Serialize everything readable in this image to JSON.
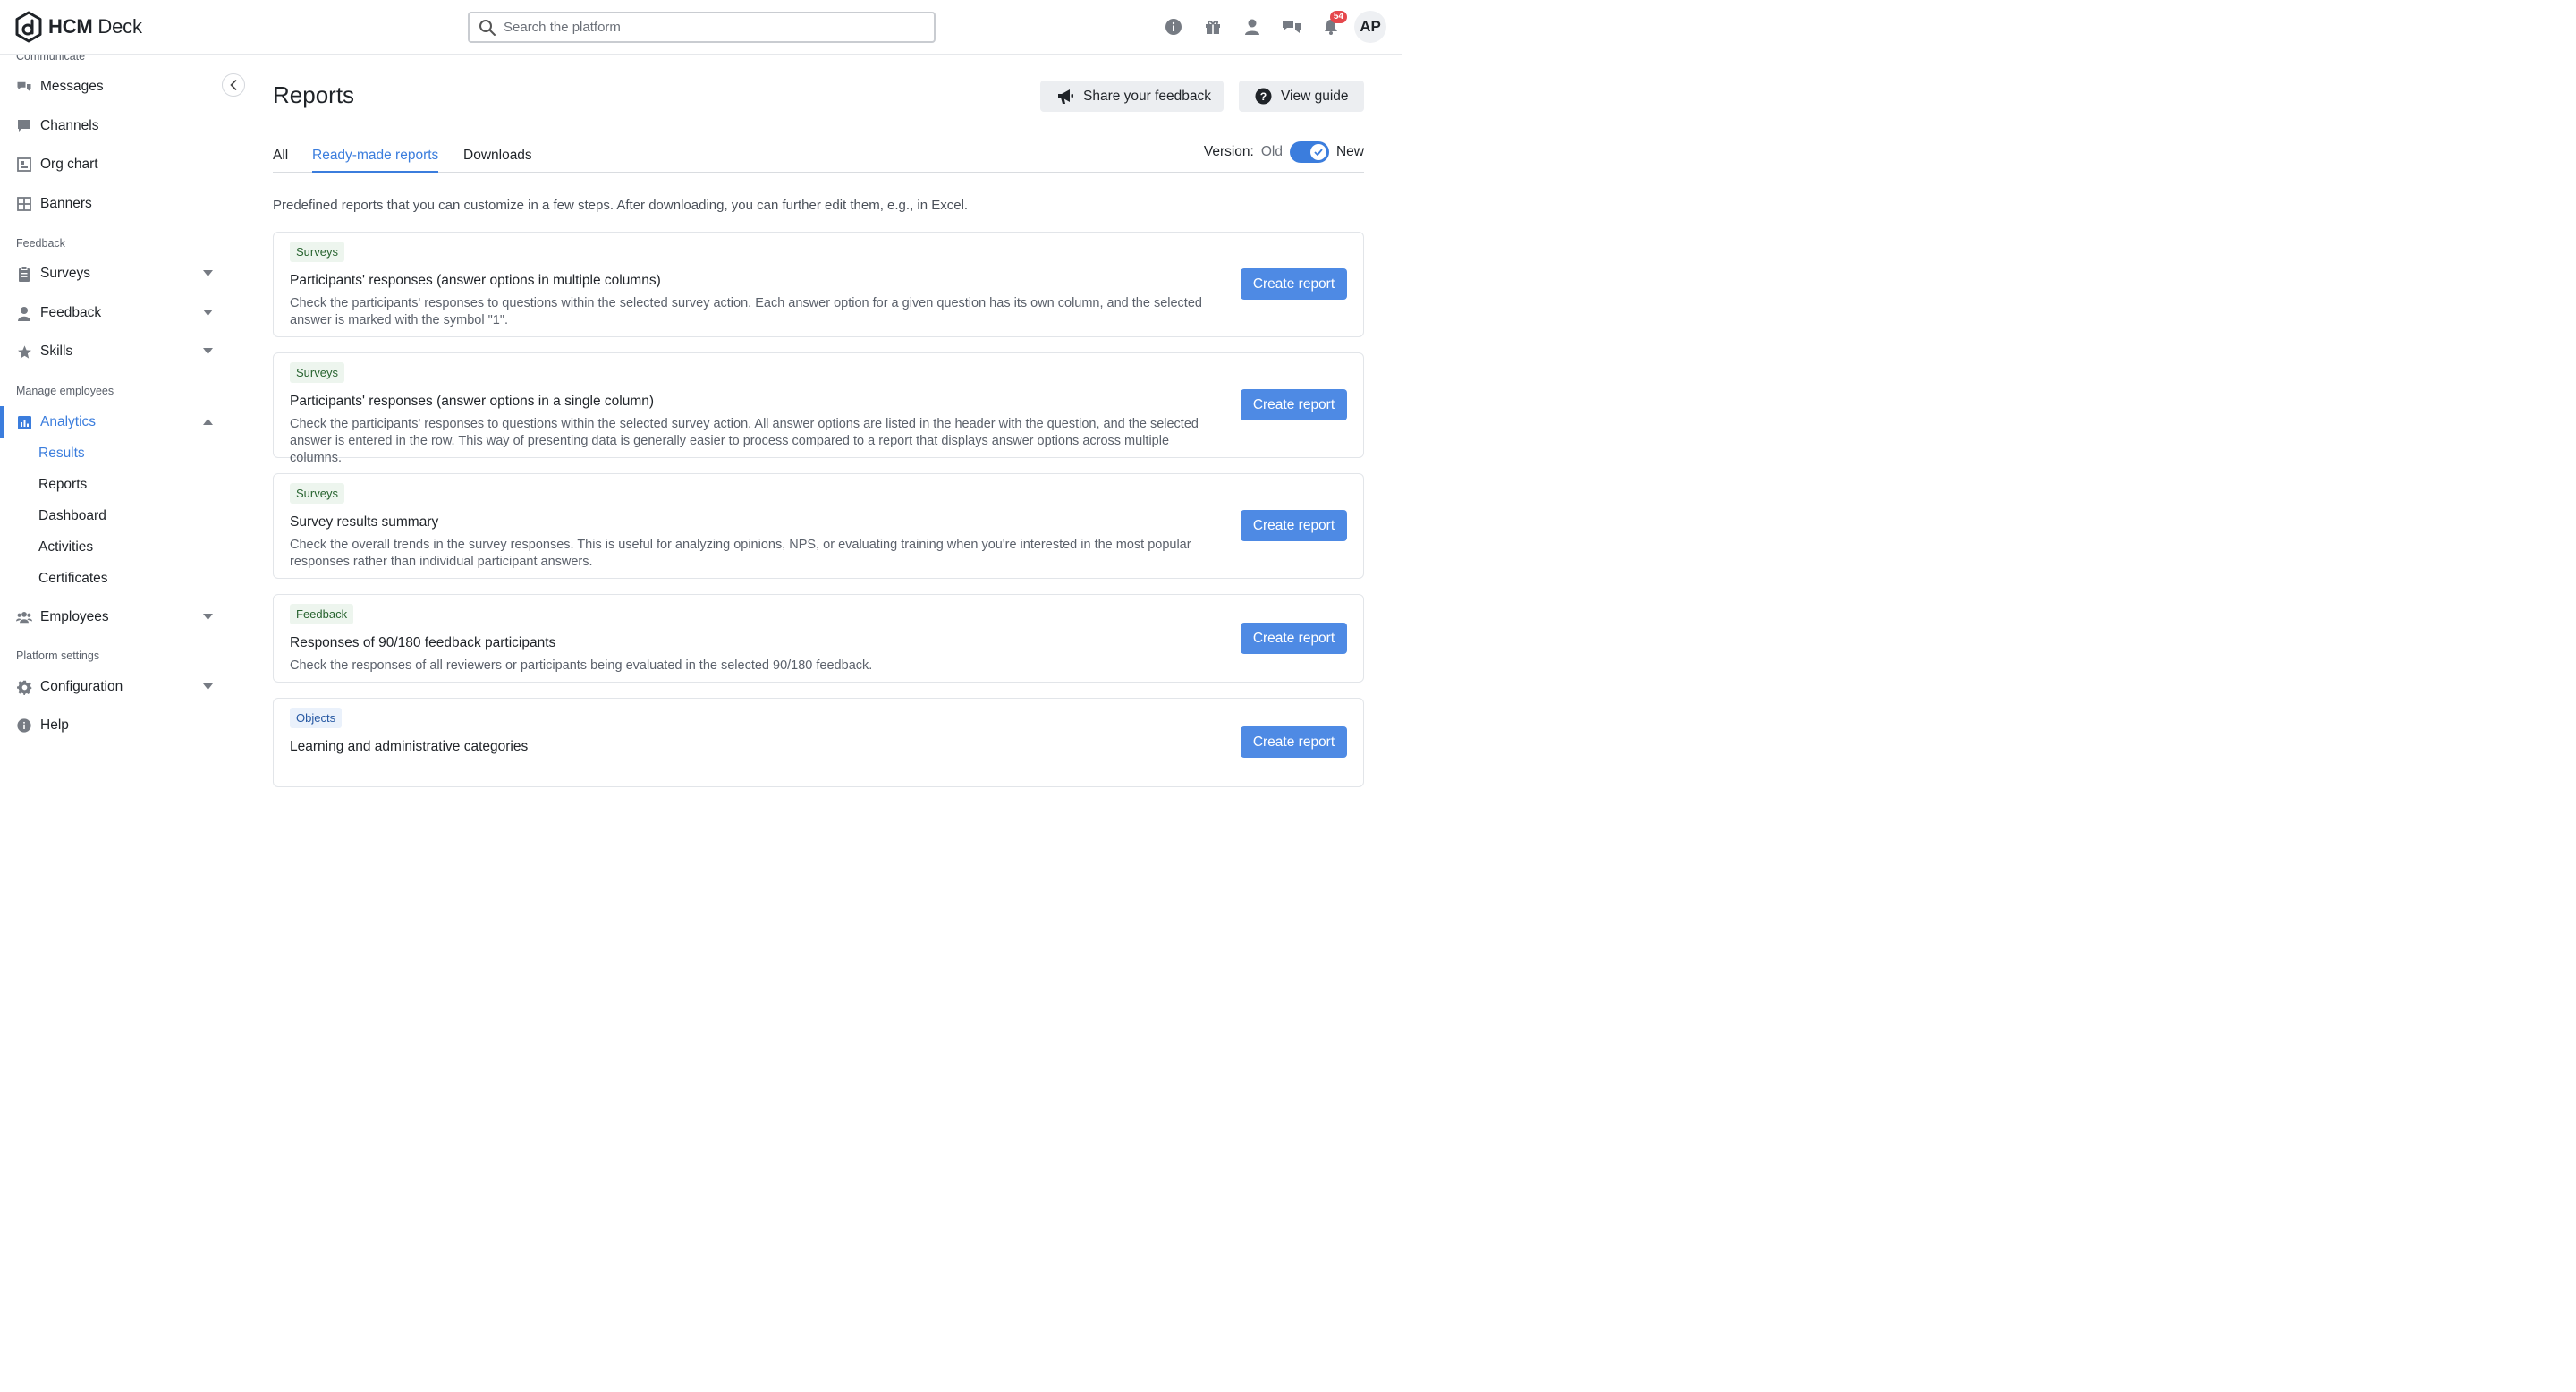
{
  "brand": {
    "name_bold": "HCM",
    "name_rest": " Deck"
  },
  "search": {
    "placeholder": "Search the platform",
    "value": ""
  },
  "topbar": {
    "icons": [
      "info-icon",
      "gift-icon",
      "user-icon",
      "chat-icon",
      "bell-icon"
    ],
    "notification_count": "54",
    "avatar_initials": "AP"
  },
  "sidebar": {
    "section_communicate": "Communicate",
    "messages": "Messages",
    "channels": "Channels",
    "org_chart": "Org chart",
    "banners": "Banners",
    "section_feedback": "Feedback",
    "surveys": "Surveys",
    "feedback": "Feedback",
    "skills": "Skills",
    "section_manage": "Manage employees",
    "analytics": "Analytics",
    "analytics_sub": [
      "Results",
      "Reports",
      "Dashboard",
      "Activities",
      "Certificates"
    ],
    "employees": "Employees",
    "section_platform": "Platform settings",
    "configuration": "Configuration",
    "help": "Help"
  },
  "main": {
    "title": "Reports",
    "share_feedback": "Share your feedback",
    "view_guide": "View guide",
    "tabs": [
      "All",
      "Ready-made reports",
      "Downloads"
    ],
    "active_tab": "Ready-made reports",
    "version_label": "Version:",
    "version_old": "Old",
    "version_new": "New",
    "intro": "Predefined reports that you can customize in a few steps. After downloading, you can further edit them, e.g., in Excel.",
    "cards": [
      {
        "tag": "Surveys",
        "title": "Participants' responses (answer options in multiple columns)",
        "desc": "Check the participants' responses to questions within the selected survey action. Each answer option for a given question has its own column, and the selected answer is marked with the symbol \"1\".",
        "button": "Create report"
      },
      {
        "tag": "Surveys",
        "title": "Participants' responses (answer options in a single column)",
        "desc": "Check the participants' responses to questions within the selected survey action. All answer options are listed in the header with the question, and the selected answer is entered in the row. This way of presenting data is generally easier to process compared to a report that displays answer options across multiple columns.",
        "button": "Create report"
      },
      {
        "tag": "Surveys",
        "title": "Survey results summary",
        "desc": "Check the overall trends in the survey responses. This is useful for analyzing opinions, NPS, or evaluating training when you're interested in the most popular responses rather than individual participant answers.",
        "button": "Create report"
      },
      {
        "tag": "Feedback",
        "title": "Responses of 90/180 feedback participants",
        "desc": "Check the responses of all reviewers or participants being evaluated in the selected 90/180 feedback.",
        "button": "Create report"
      },
      {
        "tag": "Objects",
        "title": "Learning and administrative categories",
        "desc": "",
        "button": "Create report"
      }
    ]
  },
  "colors": {
    "accent": "#3b7ddd",
    "button": "#4e8ae4",
    "badge": "#e5484d"
  }
}
